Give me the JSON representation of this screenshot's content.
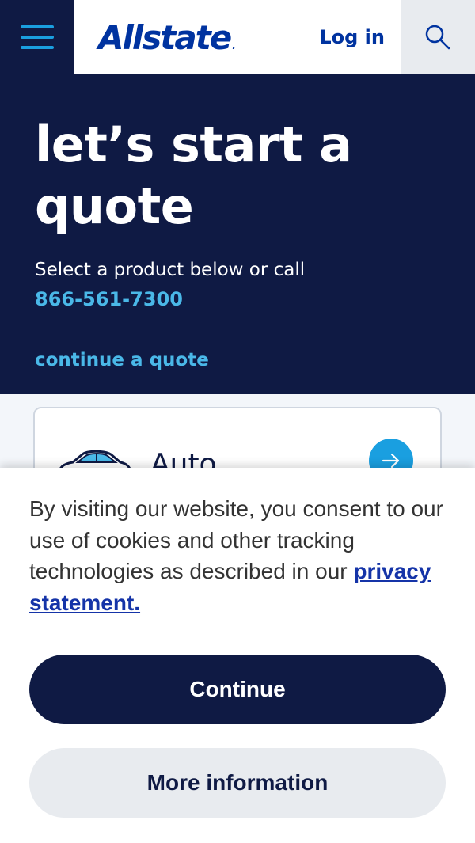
{
  "header": {
    "logo_text": "Allstate",
    "logo_mark": ".",
    "login_label": "Log in"
  },
  "hero": {
    "title_line1": "let’s start a",
    "title_line2": "quote",
    "subtitle": "Select a product below or call",
    "phone": "866-561-7300",
    "continue_label": "continue a quote"
  },
  "products": [
    {
      "label": "Auto"
    }
  ],
  "cookie": {
    "text": "By visiting our website, you consent to our use of cookies and other tracking technologies as described in our",
    "link_label": "privacy statement.",
    "continue_label": "Continue",
    "more_label": "More information"
  },
  "colors": {
    "navy": "#0f1a44",
    "brand_blue": "#0033a0",
    "accent_blue": "#1a9fe0",
    "link_blue": "#4ab8e8"
  }
}
